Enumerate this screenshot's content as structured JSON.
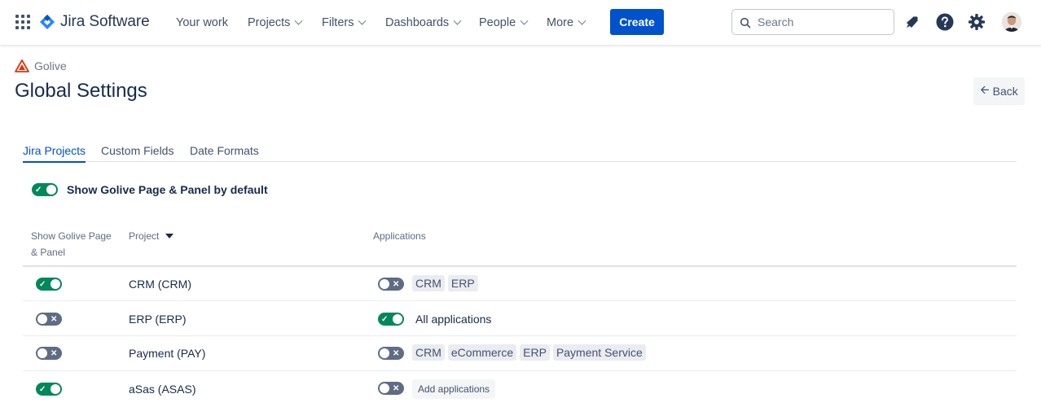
{
  "nav": {
    "product": "Jira Software",
    "items": [
      {
        "label": "Your work",
        "dropdown": false
      },
      {
        "label": "Projects",
        "dropdown": true
      },
      {
        "label": "Filters",
        "dropdown": true
      },
      {
        "label": "Dashboards",
        "dropdown": true
      },
      {
        "label": "People",
        "dropdown": true
      },
      {
        "label": "More",
        "dropdown": true
      }
    ],
    "create_label": "Create",
    "search_placeholder": "Search",
    "icons": [
      "app-switcher-icon",
      "notifications-icon",
      "help-icon",
      "settings-icon",
      "user-avatar"
    ]
  },
  "header": {
    "breadcrumb": "Golive",
    "title": "Global Settings",
    "back_label": "Back"
  },
  "tabs": [
    {
      "label": "Jira Projects",
      "active": true
    },
    {
      "label": "Custom Fields",
      "active": false
    },
    {
      "label": "Date Formats",
      "active": false
    }
  ],
  "default_toggle": {
    "label": "Show Golive Page & Panel by default",
    "on": true
  },
  "table": {
    "columns": {
      "show_line1": "Show Golive Page",
      "show_line2": "& Panel",
      "project": "Project",
      "applications": "Applications"
    },
    "rows": [
      {
        "show_panel": true,
        "project": "CRM (CRM)",
        "apps_toggle": false,
        "apps": [
          "CRM",
          "ERP"
        ],
        "all_apps_label": "",
        "add_label": ""
      },
      {
        "show_panel": false,
        "project": "ERP (ERP)",
        "apps_toggle": true,
        "apps": [],
        "all_apps_label": "All applications",
        "add_label": ""
      },
      {
        "show_panel": false,
        "project": "Payment (PAY)",
        "apps_toggle": false,
        "apps": [
          "CRM",
          "eCommerce",
          "ERP",
          "Payment Service"
        ],
        "all_apps_label": "",
        "add_label": ""
      },
      {
        "show_panel": true,
        "project": "aSas (ASAS)",
        "apps_toggle": false,
        "apps": [],
        "all_apps_label": "",
        "add_label": "Add applications"
      }
    ]
  },
  "colors": {
    "primary": "#0052cc",
    "toggle_on": "#00875a",
    "toggle_off": "#5e6c84",
    "golive_logo": "#de350b"
  }
}
